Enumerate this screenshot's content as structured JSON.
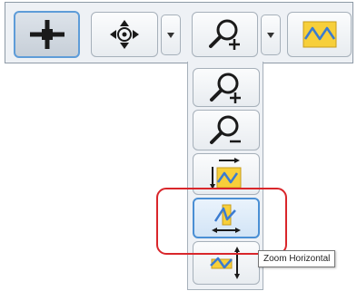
{
  "toolbar": {
    "buttons": [
      {
        "name": "pointer-tool",
        "icon": "crosshair-icon",
        "state": "active"
      },
      {
        "name": "pan-tool",
        "icon": "pan-arrows-icon",
        "state": "normal"
      },
      {
        "name": "zoom-tool",
        "icon": "zoom-in-icon",
        "state": "normal"
      },
      {
        "name": "chart-view",
        "icon": "waveform-chart-icon",
        "state": "normal"
      }
    ]
  },
  "zoom_menu": {
    "items": [
      {
        "name": "zoom-in",
        "icon": "zoom-in-icon"
      },
      {
        "name": "zoom-out",
        "icon": "zoom-out-icon"
      },
      {
        "name": "zoom-box",
        "icon": "zoom-box-icon"
      },
      {
        "name": "zoom-horizontal",
        "icon": "zoom-horizontal-icon",
        "state": "selected"
      },
      {
        "name": "zoom-vertical",
        "icon": "zoom-vertical-icon"
      }
    ]
  },
  "tooltip": {
    "text": "Zoom Horizontal"
  },
  "colors": {
    "icon_dark": "#1a1a1a",
    "chart_fill": "#f7cf3a",
    "chart_line": "#3b7bd0",
    "selected_border": "#4a8fd4",
    "highlight": "#d9262b"
  }
}
